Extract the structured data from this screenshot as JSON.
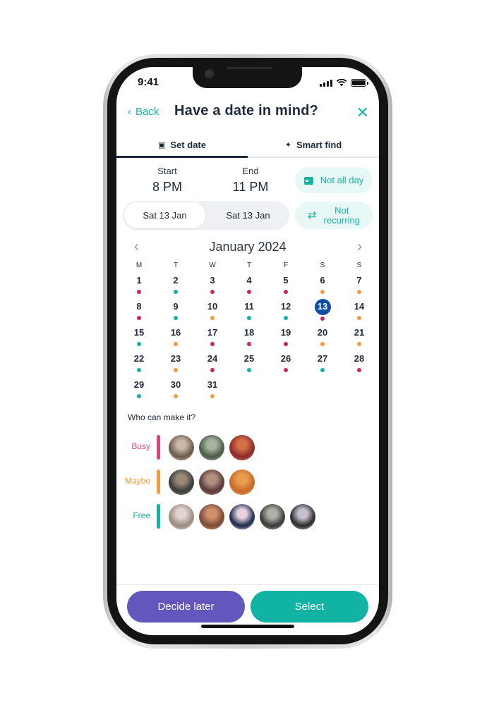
{
  "status_bar": {
    "time": "9:41"
  },
  "header": {
    "back_label": "Back",
    "title": "Have a date in mind?",
    "close_icon": "close-icon"
  },
  "tabs": [
    {
      "label": "Set date",
      "icon": "calendar-icon",
      "active": true
    },
    {
      "label": "Smart find",
      "icon": "magic-wand-icon",
      "active": false
    }
  ],
  "time_range": {
    "start_label": "Start",
    "start_value": "8 PM",
    "end_label": "End",
    "end_value": "11 PM",
    "start_date": "Sat 13 Jan",
    "end_date": "Sat 13 Jan"
  },
  "options": {
    "all_day_label": "Not all day",
    "recurring_label_line1": "Not",
    "recurring_label_line2": "recurring"
  },
  "calendar": {
    "month_title": "January 2024",
    "weekdays": [
      "M",
      "T",
      "W",
      "T",
      "F",
      "S",
      "S"
    ],
    "selected_day": 13,
    "days": [
      {
        "d": "1",
        "s": "busy"
      },
      {
        "d": "2",
        "s": "free"
      },
      {
        "d": "3",
        "s": "busy"
      },
      {
        "d": "4",
        "s": "busy"
      },
      {
        "d": "5",
        "s": "busy"
      },
      {
        "d": "6",
        "s": "maybe"
      },
      {
        "d": "7",
        "s": "maybe"
      },
      {
        "d": "8",
        "s": "busy"
      },
      {
        "d": "9",
        "s": "free"
      },
      {
        "d": "10",
        "s": "maybe"
      },
      {
        "d": "11",
        "s": "free"
      },
      {
        "d": "12",
        "s": "free"
      },
      {
        "d": "13",
        "s": "busy"
      },
      {
        "d": "14",
        "s": "maybe"
      },
      {
        "d": "15",
        "s": "free"
      },
      {
        "d": "16",
        "s": "maybe"
      },
      {
        "d": "17",
        "s": "busy"
      },
      {
        "d": "18",
        "s": "busy"
      },
      {
        "d": "19",
        "s": "busy"
      },
      {
        "d": "20",
        "s": "maybe"
      },
      {
        "d": "21",
        "s": "maybe"
      },
      {
        "d": "22",
        "s": "free"
      },
      {
        "d": "23",
        "s": "maybe"
      },
      {
        "d": "24",
        "s": "busy"
      },
      {
        "d": "25",
        "s": "free"
      },
      {
        "d": "26",
        "s": "busy"
      },
      {
        "d": "27",
        "s": "free"
      },
      {
        "d": "28",
        "s": "busy"
      },
      {
        "d": "29",
        "s": "free"
      },
      {
        "d": "30",
        "s": "maybe"
      },
      {
        "d": "31",
        "s": "maybe"
      }
    ]
  },
  "attendance": {
    "title": "Who can make it?",
    "groups": [
      {
        "label": "Busy",
        "color": "#d6467f",
        "count": 3
      },
      {
        "label": "Maybe",
        "color": "#f59a3c",
        "count": 3
      },
      {
        "label": "Free",
        "color": "#14b3a4",
        "count": 5
      }
    ]
  },
  "colors": {
    "busy": "#c8285e",
    "maybe": "#f59a3c",
    "free": "#14b3a4",
    "accent": "#14b3a4",
    "selected": "#0d4fa6"
  },
  "footer": {
    "decide_later_label": "Decide later",
    "select_label": "Select"
  }
}
